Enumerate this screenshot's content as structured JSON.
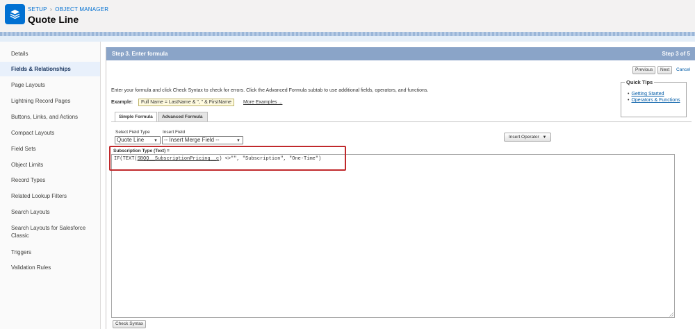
{
  "header": {
    "breadcrumb_setup": "SETUP",
    "breadcrumb_sep": "›",
    "breadcrumb_om": "OBJECT MANAGER",
    "title": "Quote Line",
    "icon": "layers-icon"
  },
  "sidebar": {
    "items": [
      {
        "label": "Details"
      },
      {
        "label": "Fields & Relationships"
      },
      {
        "label": "Page Layouts"
      },
      {
        "label": "Lightning Record Pages"
      },
      {
        "label": "Buttons, Links, and Actions"
      },
      {
        "label": "Compact Layouts"
      },
      {
        "label": "Field Sets"
      },
      {
        "label": "Object Limits"
      },
      {
        "label": "Record Types"
      },
      {
        "label": "Related Lookup Filters"
      },
      {
        "label": "Search Layouts"
      },
      {
        "label": "Search Layouts for Salesforce Classic"
      },
      {
        "label": "Triggers"
      },
      {
        "label": "Validation Rules"
      }
    ],
    "active": "Fields & Relationships"
  },
  "step": {
    "title": "Step 3. Enter formula",
    "counter": "Step 3 of 5"
  },
  "nav": {
    "previous": "Previous",
    "next": "Next",
    "cancel": "Cancel"
  },
  "instructions": "Enter your formula and click Check Syntax to check for errors. Click the Advanced Formula subtab to use additional fields, operators, and functions.",
  "example": {
    "label": "Example:",
    "value": "Full Name = LastName & \", \" & FirstName",
    "more": "More Examples ..."
  },
  "quick_tips": {
    "title": "Quick Tips",
    "links": [
      "Getting Started",
      "Operators & Functions"
    ]
  },
  "tabs": {
    "simple": "Simple Formula",
    "advanced": "Advanced Formula"
  },
  "fields": {
    "select_field_type_label": "Select Field Type",
    "select_field_type_value": "Quote Line",
    "insert_field_label": "Insert Field",
    "insert_field_value": "-- Insert Merge Field --",
    "insert_operator": "Insert Operator"
  },
  "formula": {
    "label": "Subscription Type (Text) =",
    "prefix": "IF(TEXT(",
    "field": "SBQQ__SubscriptionPricing__c",
    "suffix": ") <>\"\", \"Subscription\", \"One-Time\")"
  },
  "check_syntax": "Check Syntax",
  "colors": {
    "brand": "#0070d2",
    "step_bar": "#8aa4c8",
    "highlight": "#c0282b"
  }
}
